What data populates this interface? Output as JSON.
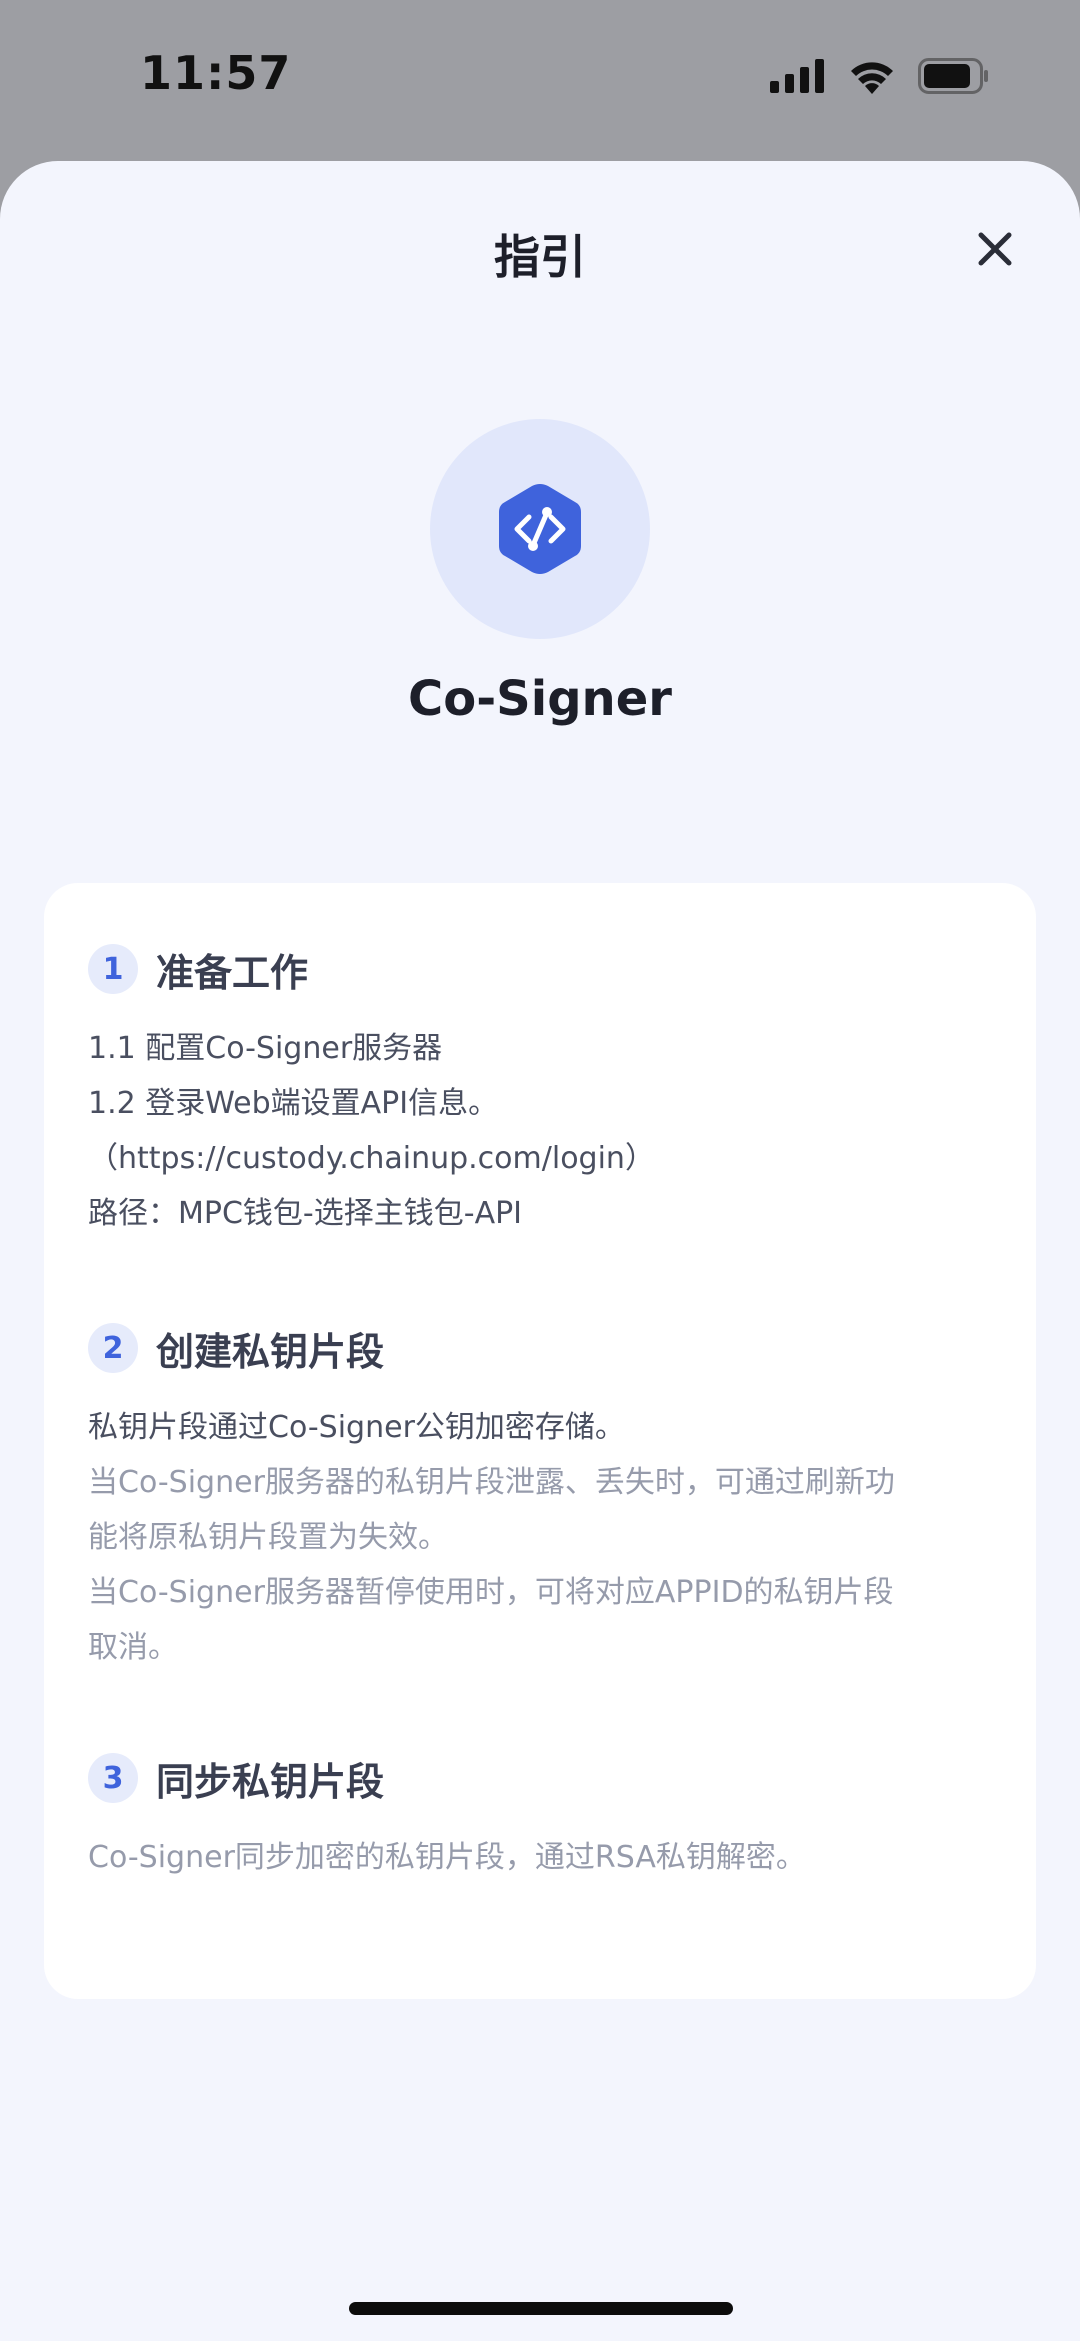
{
  "status_bar": {
    "time": "11:57",
    "icons": [
      "cellular-signal-icon",
      "wifi-icon",
      "battery-icon"
    ]
  },
  "header": {
    "title": "指引",
    "close_icon": "close-icon"
  },
  "app": {
    "name": "Co-Signer",
    "icon": "co-signer-logo-icon",
    "accent_color": "#3f63dc"
  },
  "guide": {
    "sections": [
      {
        "number": "1",
        "title": "准备工作",
        "lines": [
          "1.1 配置Co-Signer服务器",
          "1.2 登录Web端设置API信息。",
          "（https://custody.chainup.com/login）",
          "路径：MPC钱包-选择主钱包-API"
        ]
      },
      {
        "number": "2",
        "title": "创建私钥片段",
        "lines": [
          "私钥片段通过Co-Signer公钥加密存储。",
          "当Co-Signer服务器的私钥片段泄露、丢失时，可通过刷新功",
          "能将原私钥片段置为失效。",
          "当Co-Signer服务器暂停使用时，可将对应APPID的私钥片段",
          "取消。"
        ]
      },
      {
        "number": "3",
        "title": "同步私钥片段",
        "lines": [
          "Co-Signer同步加密的私钥片段，通过RSA私钥解密。"
        ]
      }
    ]
  }
}
